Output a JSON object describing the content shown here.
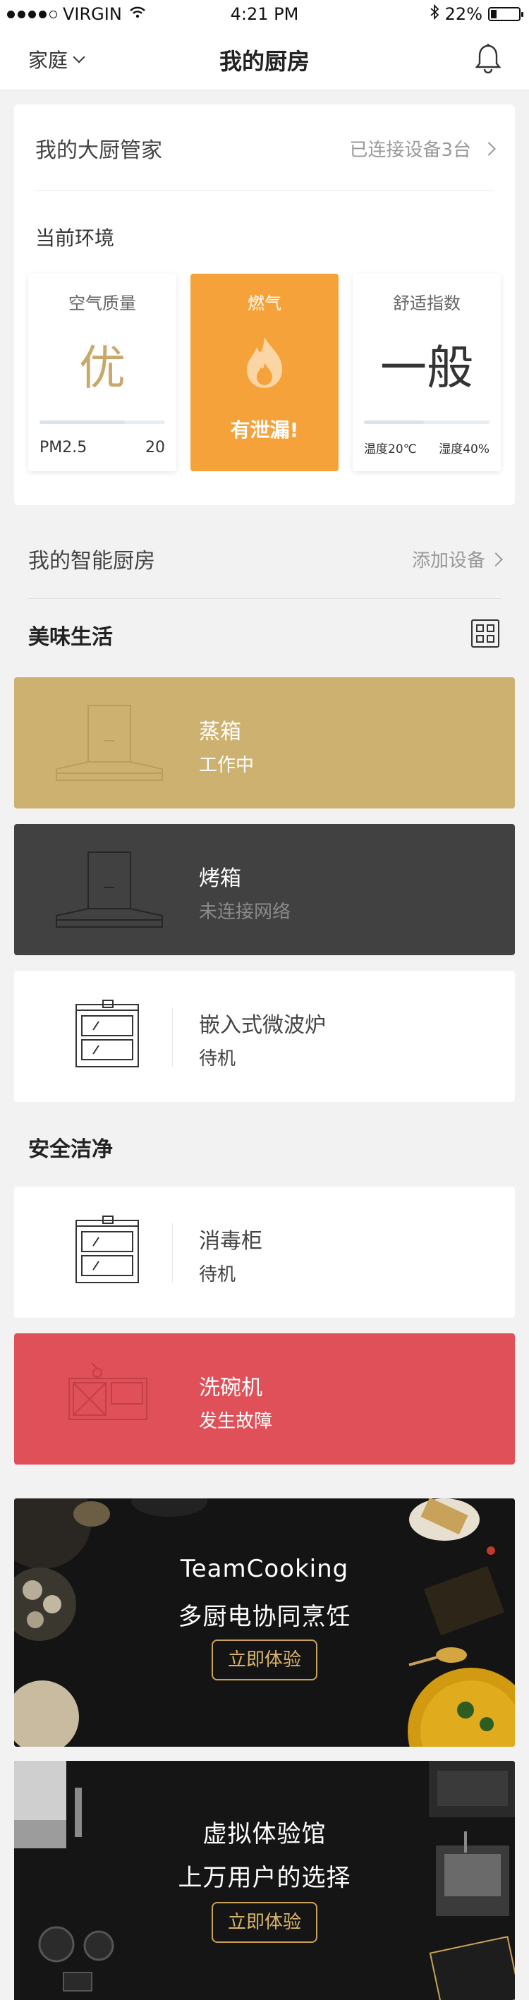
{
  "status_bar": {
    "carrier": "VIRGIN",
    "time": "4:21 PM",
    "battery": "22%",
    "battery_level": 0.22,
    "signal_bars": 4,
    "signal_total": 5
  },
  "nav": {
    "location": "家庭",
    "title": "我的厨房"
  },
  "butler": {
    "title": "我的大厨管家",
    "connected": "已连接设备3台"
  },
  "environment": {
    "title": "当前环境",
    "air": {
      "label": "空气质量",
      "value": "优",
      "metric": "PM2.5",
      "metric_value": "20",
      "level": 0.68
    },
    "gas": {
      "label": "燃气",
      "status": "有泄漏!"
    },
    "comfort": {
      "label": "舒适指数",
      "value": "一般",
      "temp": "温度20℃",
      "humidity": "湿度40%",
      "level": 0.48
    }
  },
  "smart_kitchen": {
    "title": "我的智能厨房",
    "add": "添加设备"
  },
  "sections": {
    "delicious": "美味生活",
    "safety": "安全洁净"
  },
  "devices": [
    {
      "name": "蒸箱",
      "status": "工作中",
      "color": "#cdb171"
    },
    {
      "name": "烤箱",
      "status": "未连接网络",
      "color": "#414141"
    },
    {
      "name": "嵌入式微波炉",
      "status": "待机",
      "color": "#ffffff"
    },
    {
      "name": "消毒柜",
      "status": "待机",
      "color": "#ffffff"
    },
    {
      "name": "洗碗机",
      "status": "发生故障",
      "color": "#e05058"
    }
  ],
  "banners": [
    {
      "line1": "TeamCooking",
      "line2": "多厨电协同烹饪",
      "cta": "立即体验"
    },
    {
      "line1": "虚拟体验馆",
      "line2": "上万用户的选择",
      "cta": "立即体验"
    }
  ],
  "colors": {
    "accent_gold": "#c8a96a",
    "gas_orange": "#f6a23a",
    "steamer_gold": "#cdb171",
    "oven_dark": "#414141",
    "fault_red": "#e05058"
  }
}
